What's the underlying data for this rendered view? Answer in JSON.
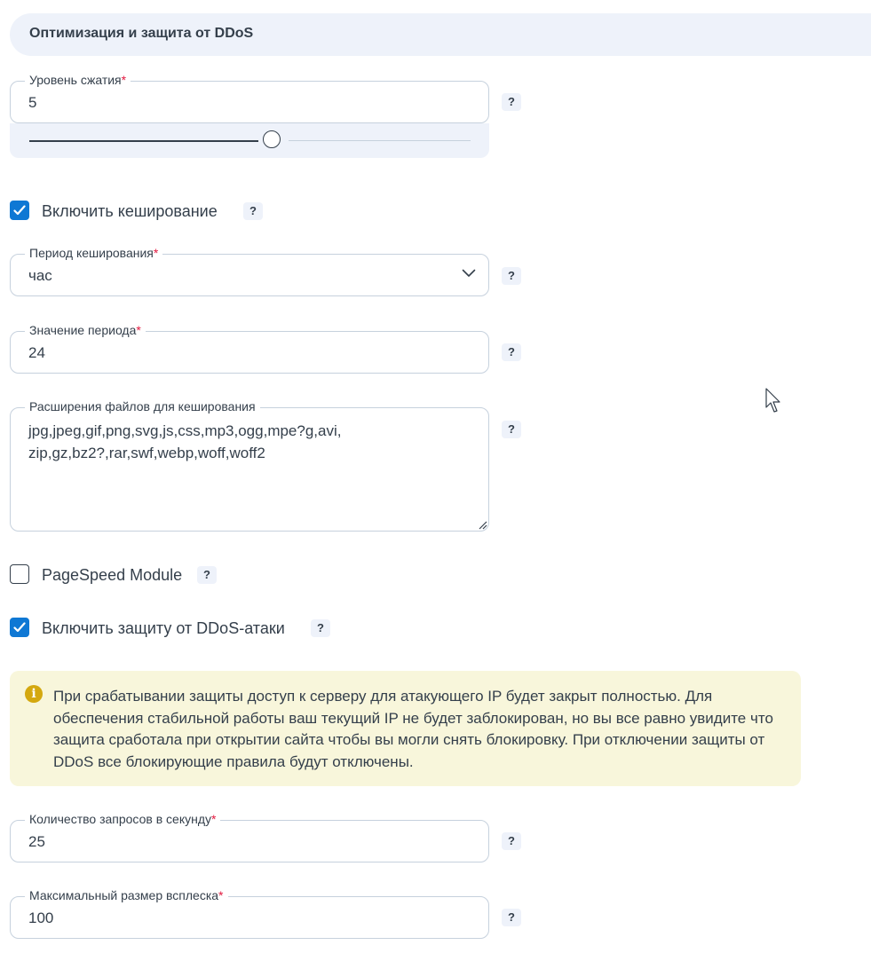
{
  "section": {
    "title": "Оптимизация и защита от DDoS"
  },
  "compression": {
    "label": "Уровень сжатия",
    "required_mark": "*",
    "value": "5",
    "slider_level": 5,
    "slider_max": 9
  },
  "caching": {
    "label": "Включить кеширование",
    "checked": true
  },
  "cache_period": {
    "label": "Период кеширования",
    "required_mark": "*",
    "value": "час"
  },
  "period_value": {
    "label": "Значение периода",
    "required_mark": "*",
    "value": "24"
  },
  "extensions": {
    "label": "Расширения файлов для кеширования",
    "value": "jpg,jpeg,gif,png,svg,js,css,mp3,ogg,mpe?g,avi,zip,gz,bz2?,rar,swf,webp,woff,woff2"
  },
  "pagespeed": {
    "label": "PageSpeed Module",
    "checked": false
  },
  "ddos": {
    "label": "Включить защиту от DDoS-атаки",
    "checked": true
  },
  "info": {
    "icon": "info-icon",
    "text": "При срабатывании защиты доступ к серверу для атакующего IP будет закрыт полностью. Для обеспечения стабильной работы ваш текущий IP не будет заблокирован, но вы все равно увидите что защита сработала при открытии сайта чтобы вы могли снять блокировку. При отключении защиты от DDoS все блокирующие правила будут отключены."
  },
  "requests_per_second": {
    "label": "Количество запросов в секунду",
    "required_mark": "*",
    "value": "25"
  },
  "burst": {
    "label": "Максимальный размер всплеска",
    "required_mark": "*",
    "value": "100"
  },
  "help_label": "?",
  "colors": {
    "accent": "#0f78d4",
    "required": "#e2193f",
    "header_bg": "#eef2fa",
    "info_bg": "#f8f6db",
    "info_icon": "#d4a80f",
    "border": "#c6d1dd"
  }
}
